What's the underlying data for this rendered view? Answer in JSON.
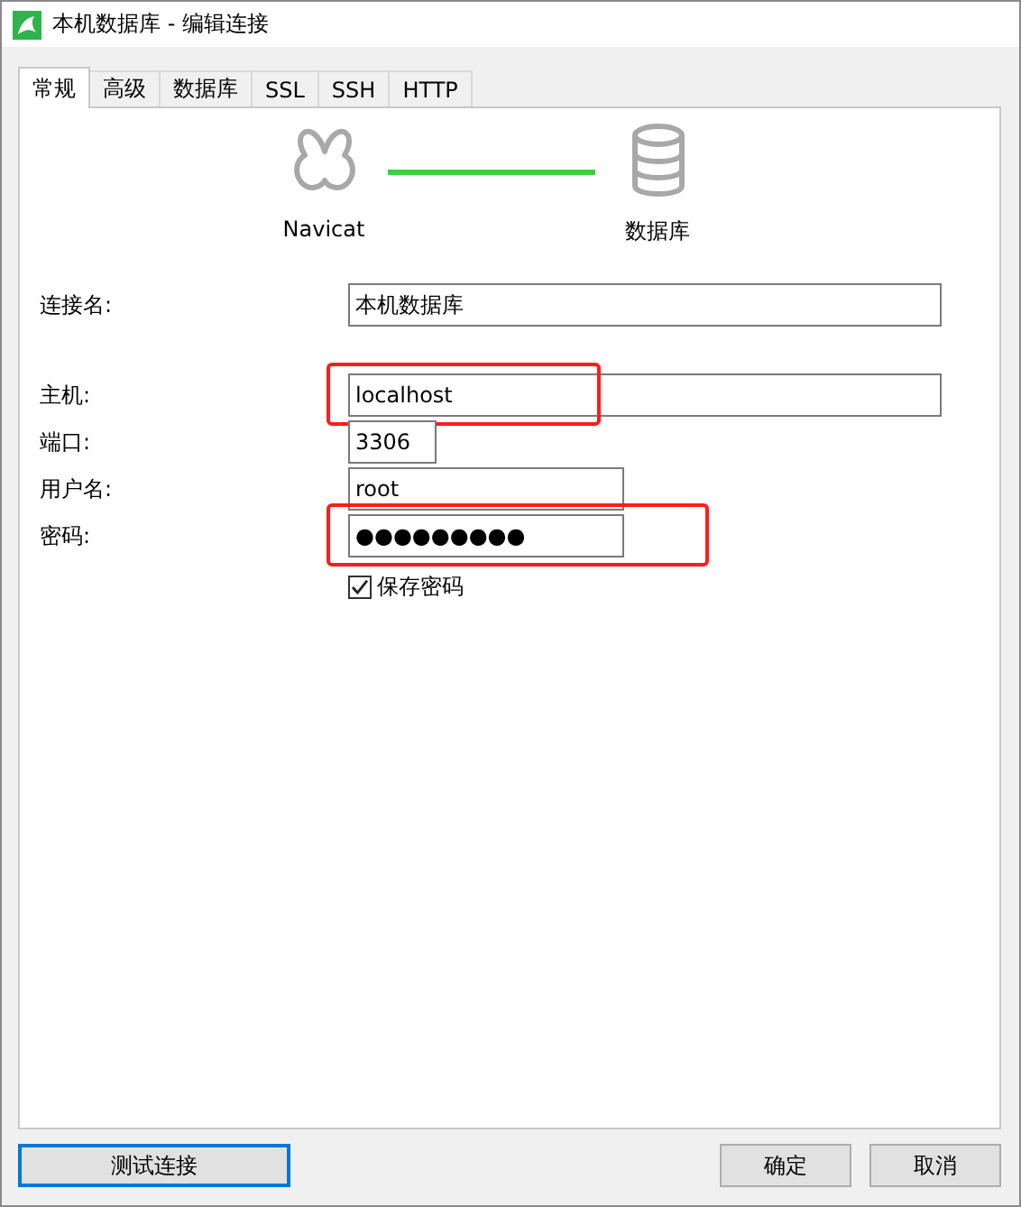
{
  "window": {
    "title": "本机数据库 - 编辑连接"
  },
  "tabs": [
    {
      "label": "常规",
      "selected": true
    },
    {
      "label": "高级",
      "selected": false
    },
    {
      "label": "数据库",
      "selected": false
    },
    {
      "label": "SSL",
      "selected": false
    },
    {
      "label": "SSH",
      "selected": false
    },
    {
      "label": "HTTP",
      "selected": false
    }
  ],
  "diagram": {
    "left_label": "Navicat",
    "right_label": "数据库"
  },
  "field_groups": [
    [
      {
        "label": "连接名:",
        "value": "本机数据库",
        "kind": "wide",
        "highlighted": false
      }
    ],
    [
      {
        "label": "主机:",
        "value": "localhost",
        "kind": "wide",
        "highlighted": true
      },
      {
        "label": "端口:",
        "value": "3306",
        "kind": "short",
        "highlighted": false
      },
      {
        "label": "用户名:",
        "value": "root",
        "kind": "medium",
        "highlighted": false
      },
      {
        "label": "密码:",
        "value": "●●●●●●●●●",
        "kind": "medium",
        "highlighted": true
      }
    ]
  ],
  "save_password": {
    "label": "保存密码",
    "checked": true
  },
  "buttons": {
    "test": "测试连接",
    "ok": "确定",
    "cancel": "取消"
  }
}
